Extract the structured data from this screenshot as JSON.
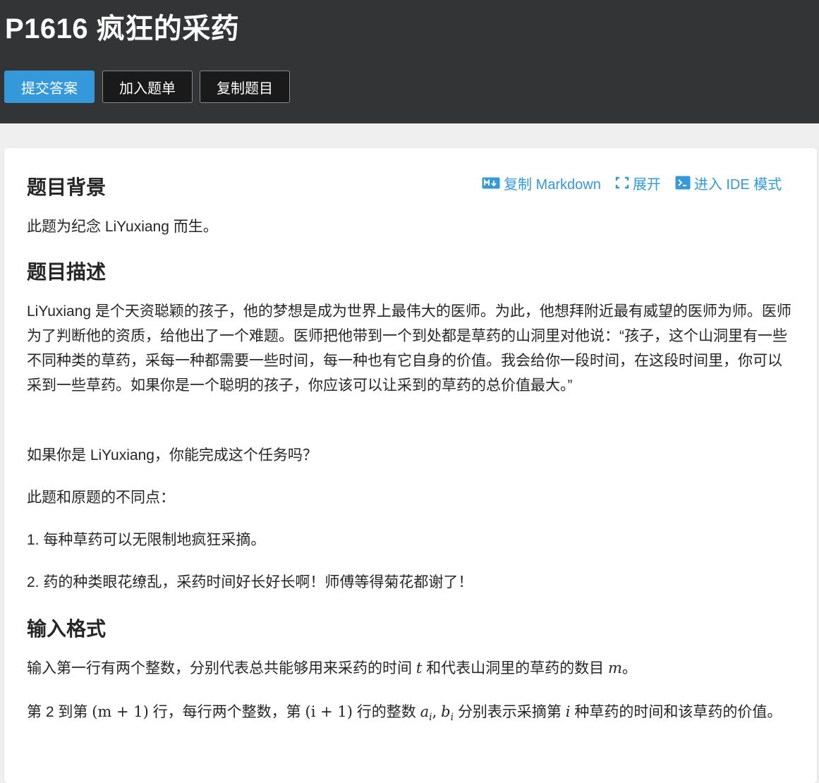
{
  "header": {
    "title": "P1616 疯狂的采药",
    "buttons": {
      "submit": "提交答案",
      "add_to_list": "加入题单",
      "copy_problem": "复制题目"
    }
  },
  "toolbar": {
    "copy_markdown": "复制 Markdown",
    "expand": "展开",
    "ide_mode": "进入 IDE 模式"
  },
  "sections": {
    "background": {
      "heading": "题目背景",
      "text": "此题为纪念 LiYuxiang 而生。"
    },
    "description": {
      "heading": "题目描述",
      "p1": "LiYuxiang 是个天资聪颖的孩子，他的梦想是成为世界上最伟大的医师。为此，他想拜附近最有威望的医师为师。医师为了判断他的资质，给他出了一个难题。医师把他带到一个到处都是草药的山洞里对他说：“孩子，这个山洞里有一些不同种类的草药，采每一种都需要一些时间，每一种也有它自身的价值。我会给你一段时间，在这段时间里，你可以采到一些草药。如果你是一个聪明的孩子，你应该可以让采到的草药的总价值最大。”",
      "p2": "如果你是 LiYuxiang，你能完成这个任务吗？",
      "p3": "此题和原题的不同点：",
      "p4": "1. 每种草药可以无限制地疯狂采摘。",
      "p5": "2. 药的种类眼花缭乱，采药时间好长好长啊！师傅等得菊花都谢了！"
    },
    "input": {
      "heading": "输入格式",
      "p1_a": "输入第一行有两个整数，分别代表总共能够用来采药的时间",
      "p1_t": "t",
      "p1_b": "和代表山洞里的草药的数目",
      "p1_m": "m",
      "p1_c": "。",
      "p2_a": "第 2 到第",
      "p2_math1": "(m + 1)",
      "p2_b": "行，每行两个整数，第",
      "p2_math2": "(i + 1)",
      "p2_c": "行的整数",
      "p2_ai": "a",
      "p2_i1": "i",
      "p2_comma": ",",
      "p2_bi": "b",
      "p2_i2": "i",
      "p2_d": "分别表示采摘第",
      "p2_i3": "i",
      "p2_e": "种草药的时间和该草药的价值。"
    }
  },
  "colors": {
    "header_bg": "#333436",
    "accent": "#3498db",
    "page_bg": "#efefef"
  }
}
